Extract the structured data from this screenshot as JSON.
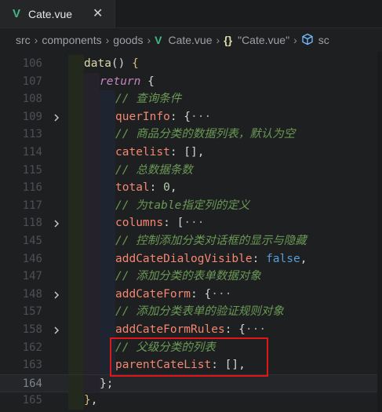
{
  "tab": {
    "label": "Cate.vue",
    "close": "✕"
  },
  "breadcrumb": {
    "items": [
      "src",
      "components",
      "goods",
      "Cate.vue",
      "\"Cate.vue\"",
      "sc"
    ],
    "separator": "›"
  },
  "code_lines": [
    {
      "num": "106",
      "indent": 1,
      "fold": false,
      "tokens": [
        {
          "t": "data",
          "c": "fn"
        },
        {
          "t": "() ",
          "c": "punc"
        },
        {
          "t": "{",
          "c": "brace"
        }
      ]
    },
    {
      "num": "107",
      "indent": 2,
      "fold": false,
      "tokens": [
        {
          "t": "return",
          "c": "kw"
        },
        {
          "t": " {",
          "c": "punc"
        }
      ]
    },
    {
      "num": "108",
      "indent": 3,
      "fold": false,
      "tokens": [
        {
          "t": "// 查询条件",
          "c": "com"
        }
      ]
    },
    {
      "num": "109",
      "indent": 3,
      "fold": true,
      "tokens": [
        {
          "t": "querInfo",
          "c": "prop"
        },
        {
          "t": ": {",
          "c": "punc"
        },
        {
          "t": "···",
          "c": "fold"
        }
      ]
    },
    {
      "num": "113",
      "indent": 3,
      "fold": false,
      "tokens": [
        {
          "t": "// 商品分类的数据列表，默认为空",
          "c": "com"
        }
      ]
    },
    {
      "num": "114",
      "indent": 3,
      "fold": false,
      "tokens": [
        {
          "t": "catelist",
          "c": "prop"
        },
        {
          "t": ": [],",
          "c": "punc"
        }
      ]
    },
    {
      "num": "115",
      "indent": 3,
      "fold": false,
      "tokens": [
        {
          "t": "// 总数据条数",
          "c": "com"
        }
      ]
    },
    {
      "num": "116",
      "indent": 3,
      "fold": false,
      "tokens": [
        {
          "t": "total",
          "c": "prop"
        },
        {
          "t": ": ",
          "c": "punc"
        },
        {
          "t": "0",
          "c": "num"
        },
        {
          "t": ",",
          "c": "punc"
        }
      ]
    },
    {
      "num": "117",
      "indent": 3,
      "fold": false,
      "tokens": [
        {
          "t": "// 为table指定列的定义",
          "c": "com"
        }
      ]
    },
    {
      "num": "118",
      "indent": 3,
      "fold": true,
      "tokens": [
        {
          "t": "columns",
          "c": "prop"
        },
        {
          "t": ": [",
          "c": "punc"
        },
        {
          "t": "···",
          "c": "fold"
        }
      ]
    },
    {
      "num": "145",
      "indent": 3,
      "fold": false,
      "tokens": [
        {
          "t": "// 控制添加分类对话框的显示与隐藏",
          "c": "com"
        }
      ]
    },
    {
      "num": "146",
      "indent": 3,
      "fold": false,
      "tokens": [
        {
          "t": "addCateDialogVisible",
          "c": "prop"
        },
        {
          "t": ": ",
          "c": "punc"
        },
        {
          "t": "false",
          "c": "bool"
        },
        {
          "t": ",",
          "c": "punc"
        }
      ]
    },
    {
      "num": "147",
      "indent": 3,
      "fold": false,
      "tokens": [
        {
          "t": "// 添加分类的表单数据对象",
          "c": "com"
        }
      ]
    },
    {
      "num": "148",
      "indent": 3,
      "fold": true,
      "tokens": [
        {
          "t": "addCateForm",
          "c": "prop"
        },
        {
          "t": ": {",
          "c": "punc"
        },
        {
          "t": "···",
          "c": "fold"
        }
      ]
    },
    {
      "num": "157",
      "indent": 3,
      "fold": false,
      "tokens": [
        {
          "t": "// 添加分类表单的验证规则对象",
          "c": "com"
        }
      ]
    },
    {
      "num": "158",
      "indent": 3,
      "fold": true,
      "tokens": [
        {
          "t": "addCateFormRules",
          "c": "prop"
        },
        {
          "t": ": {",
          "c": "punc"
        },
        {
          "t": "···",
          "c": "fold"
        }
      ]
    },
    {
      "num": "162",
      "indent": 3,
      "fold": false,
      "tokens": [
        {
          "t": "// 父级分类的列表",
          "c": "com"
        }
      ]
    },
    {
      "num": "163",
      "indent": 3,
      "fold": false,
      "tokens": [
        {
          "t": "parentCateList",
          "c": "prop"
        },
        {
          "t": ": [],",
          "c": "punc"
        }
      ]
    },
    {
      "num": "164",
      "indent": 2,
      "fold": false,
      "current": true,
      "tokens": [
        {
          "t": "};",
          "c": "punc"
        }
      ]
    },
    {
      "num": "165",
      "indent": 1,
      "fold": false,
      "tokens": [
        {
          "t": "}",
          "c": "brace"
        },
        {
          "t": ",",
          "c": "punc"
        }
      ]
    }
  ],
  "colors": {
    "background": "#1e1f21",
    "comment": "#6a9955",
    "property": "#f48771",
    "keyword": "#c586c0",
    "highlight_box": "#e0161a",
    "vue_logo": "#41b883"
  }
}
